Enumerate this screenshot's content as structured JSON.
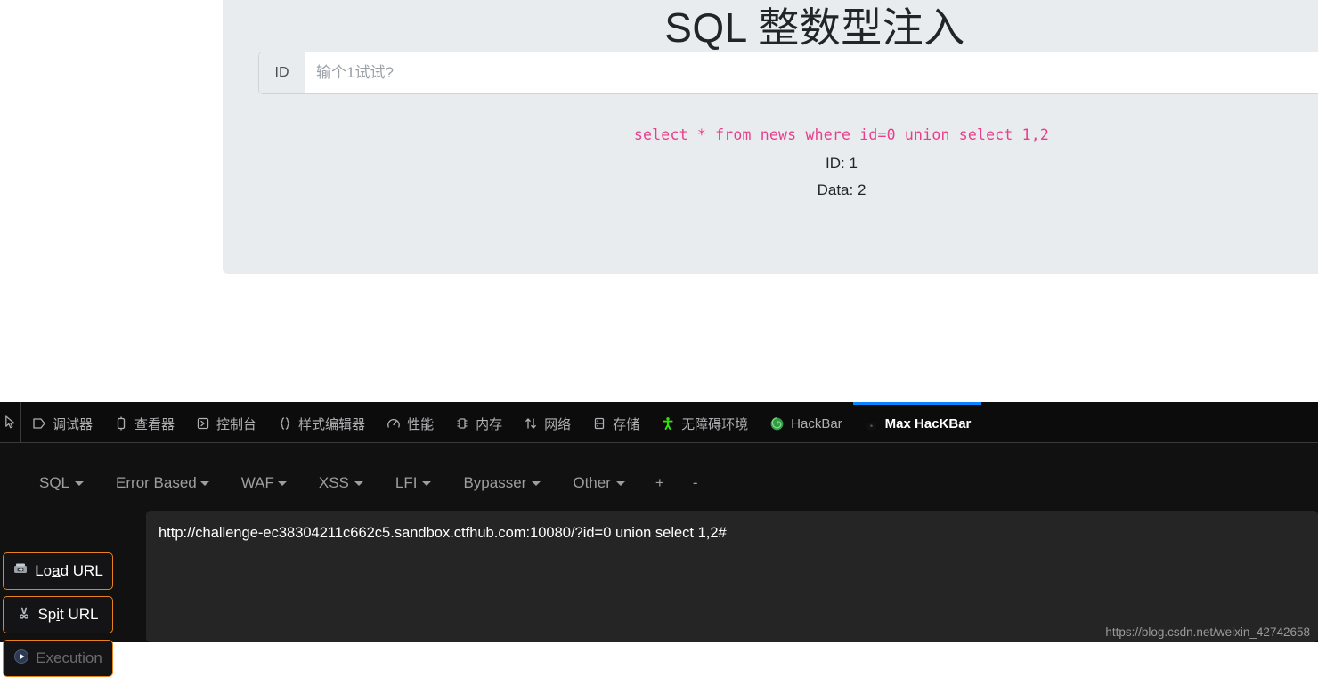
{
  "page": {
    "title": "SQL 整数型注入",
    "input_group": {
      "prepend_label": "ID",
      "placeholder": "输个1试试?",
      "value": ""
    },
    "sql_query": "select * from news where id=0 union select 1,2",
    "result_id": "ID: 1",
    "result_data": "Data: 2",
    "colors": {
      "panel_bg": "#e9ecef",
      "query_text": "#e83e8c",
      "title_text": "#212529"
    }
  },
  "devtools": {
    "picker_icon": "element-picker-icon",
    "tabs": [
      {
        "label": "调试器",
        "icon": "debugger-icon",
        "active": false
      },
      {
        "label": "查看器",
        "icon": "inspector-icon",
        "active": false
      },
      {
        "label": "控制台",
        "icon": "console-icon",
        "active": false
      },
      {
        "label": "样式编辑器",
        "icon": "style-editor-icon",
        "active": false
      },
      {
        "label": "性能",
        "icon": "performance-icon",
        "active": false
      },
      {
        "label": "内存",
        "icon": "memory-icon",
        "active": false
      },
      {
        "label": "网络",
        "icon": "network-icon",
        "active": false
      },
      {
        "label": "存储",
        "icon": "storage-icon",
        "active": false
      },
      {
        "label": "无障碍环境",
        "icon": "accessibility-icon",
        "active": false
      },
      {
        "label": "HackBar",
        "icon": "firefox-icon",
        "active": false
      },
      {
        "label": "Max HacKBar",
        "icon": "lock-icon",
        "active": true
      }
    ],
    "active_tab_accent": "#0a84ff"
  },
  "hackbar": {
    "menu": [
      {
        "label": "SQL",
        "has_caret": true
      },
      {
        "label": "Error Based",
        "has_caret": true
      },
      {
        "label": "WAF",
        "has_caret": true
      },
      {
        "label": "XSS",
        "has_caret": true
      },
      {
        "label": "LFI",
        "has_caret": true
      },
      {
        "label": "Bypasser",
        "has_caret": true
      },
      {
        "label": "Other",
        "has_caret": true
      }
    ],
    "add_label": "+",
    "remove_label": "-",
    "buttons": [
      {
        "label_pre": "Lo",
        "label_underline": "a",
        "label_post": "d URL",
        "icon": "load-url-icon",
        "disabled": false
      },
      {
        "label_pre": "Sp",
        "label_underline": "i",
        "label_post": "t URL",
        "icon": "spit-url-icon",
        "disabled": false
      },
      {
        "label_pre": "Execution",
        "label_underline": "",
        "label_post": "",
        "icon": "play-icon",
        "disabled": true
      }
    ],
    "url": "http://challenge-ec38304211c662c5.sandbox.ctfhub.com:10080/?id=0 union select 1,2#",
    "button_border_color": "#e8821e"
  },
  "watermark": "https://blog.csdn.net/weixin_42742658"
}
